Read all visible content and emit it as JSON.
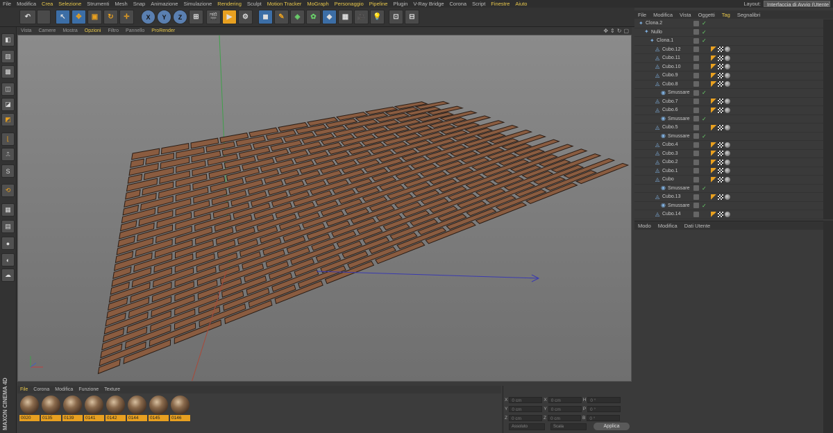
{
  "menubar": {
    "items": [
      {
        "label": "File",
        "hl": false
      },
      {
        "label": "Modifica",
        "hl": false
      },
      {
        "label": "Crea",
        "hl": true
      },
      {
        "label": "Selezione",
        "hl": true
      },
      {
        "label": "Strumenti",
        "hl": false
      },
      {
        "label": "Mesh",
        "hl": false
      },
      {
        "label": "Snap",
        "hl": false
      },
      {
        "label": "Animazione",
        "hl": false
      },
      {
        "label": "Simulazione",
        "hl": false
      },
      {
        "label": "Rendering",
        "hl": true
      },
      {
        "label": "Sculpt",
        "hl": false
      },
      {
        "label": "Motion Tracker",
        "hl": true
      },
      {
        "label": "MoGraph",
        "hl": true
      },
      {
        "label": "Personaggio",
        "hl": true
      },
      {
        "label": "Pipeline",
        "hl": true
      },
      {
        "label": "Plugin",
        "hl": false
      },
      {
        "label": "V-Ray Bridge",
        "hl": false
      },
      {
        "label": "Corona",
        "hl": false
      },
      {
        "label": "Script",
        "hl": false
      },
      {
        "label": "Finestre",
        "hl": true
      },
      {
        "label": "Aiuto",
        "hl": true
      }
    ],
    "layout_label": "Layout:",
    "layout_value": "Interfaccia di Avvio (Utente)"
  },
  "toolbar": {
    "undo": "↶",
    "axis_x": "X",
    "axis_y": "Y",
    "axis_z": "Z"
  },
  "viewport": {
    "menu": [
      {
        "label": "Vista",
        "hl": false
      },
      {
        "label": "Camere",
        "hl": false
      },
      {
        "label": "Mostra",
        "hl": false
      },
      {
        "label": "Opzioni",
        "hl": true
      },
      {
        "label": "Filtro",
        "hl": false
      },
      {
        "label": "Pannello",
        "hl": false
      },
      {
        "label": "ProRender",
        "hl": true
      }
    ]
  },
  "materials": {
    "menu": [
      {
        "label": "File",
        "hl": true
      },
      {
        "label": "Corona",
        "hl": false
      },
      {
        "label": "Modifica",
        "hl": false
      },
      {
        "label": "Funzione",
        "hl": false
      },
      {
        "label": "Texture",
        "hl": false
      }
    ],
    "items": [
      "0020",
      "0135",
      "0139",
      "0141",
      "0142",
      "0144",
      "0145",
      "0146"
    ]
  },
  "coords": {
    "rows": [
      {
        "a": "X",
        "av": "0 cm",
        "b": "X",
        "bv": "0 cm",
        "c": "H",
        "cv": "0 °"
      },
      {
        "a": "Y",
        "av": "0 cm",
        "b": "Y",
        "bv": "0 cm",
        "c": "P",
        "cv": "0 °"
      },
      {
        "a": "Z",
        "av": "0 cm",
        "b": "Z",
        "bv": "0 cm",
        "c": "B",
        "cv": "0 °"
      }
    ],
    "mode1": "Assoluto",
    "mode2": "Scala",
    "apply": "Applica"
  },
  "object_manager": {
    "menu": [
      {
        "label": "File",
        "hl": false
      },
      {
        "label": "Modifica",
        "hl": false
      },
      {
        "label": "Vista",
        "hl": false
      },
      {
        "label": "Oggetti",
        "hl": false
      },
      {
        "label": "Tag",
        "hl": true
      },
      {
        "label": "Segnalibri",
        "hl": false
      }
    ],
    "objects": [
      {
        "name": "Clona.2",
        "indent": 0,
        "tags": 0
      },
      {
        "name": "Nullo",
        "indent": 1,
        "tags": 0
      },
      {
        "name": "Clona.1",
        "indent": 2,
        "tags": 0
      },
      {
        "name": "Cubo.12",
        "indent": 3,
        "tags": 3
      },
      {
        "name": "Cubo.11",
        "indent": 3,
        "tags": 3
      },
      {
        "name": "Cubo.10",
        "indent": 3,
        "tags": 3
      },
      {
        "name": "Cubo.9",
        "indent": 3,
        "tags": 3
      },
      {
        "name": "Cubo.8",
        "indent": 3,
        "tags": 3
      },
      {
        "name": "Smussare",
        "indent": 4,
        "tags": 0
      },
      {
        "name": "Cubo.7",
        "indent": 3,
        "tags": 3
      },
      {
        "name": "Cubo.6",
        "indent": 3,
        "tags": 3
      },
      {
        "name": "Smussare",
        "indent": 4,
        "tags": 0
      },
      {
        "name": "Cubo.5",
        "indent": 3,
        "tags": 3
      },
      {
        "name": "Smussare",
        "indent": 4,
        "tags": 0
      },
      {
        "name": "Cubo.4",
        "indent": 3,
        "tags": 3
      },
      {
        "name": "Cubo.3",
        "indent": 3,
        "tags": 3
      },
      {
        "name": "Cubo.2",
        "indent": 3,
        "tags": 3
      },
      {
        "name": "Cubo.1",
        "indent": 3,
        "tags": 3
      },
      {
        "name": "Cubo",
        "indent": 3,
        "tags": 3
      },
      {
        "name": "Smussare",
        "indent": 4,
        "tags": 0
      },
      {
        "name": "Cubo.13",
        "indent": 3,
        "tags": 3
      },
      {
        "name": "Smussare",
        "indent": 4,
        "tags": 0
      },
      {
        "name": "Cubo.14",
        "indent": 3,
        "tags": 3
      }
    ]
  },
  "attribute_manager": {
    "menu": [
      "Modo",
      "Modifica",
      "Dati Utente"
    ]
  },
  "branding": {
    "logo_text": "MAXON CINEMA 4D"
  },
  "colors": {
    "accent": "#e8c84c",
    "plank": "#8a5c40",
    "plank_edge": "#2a1c14",
    "material_label": "#e8a020"
  }
}
